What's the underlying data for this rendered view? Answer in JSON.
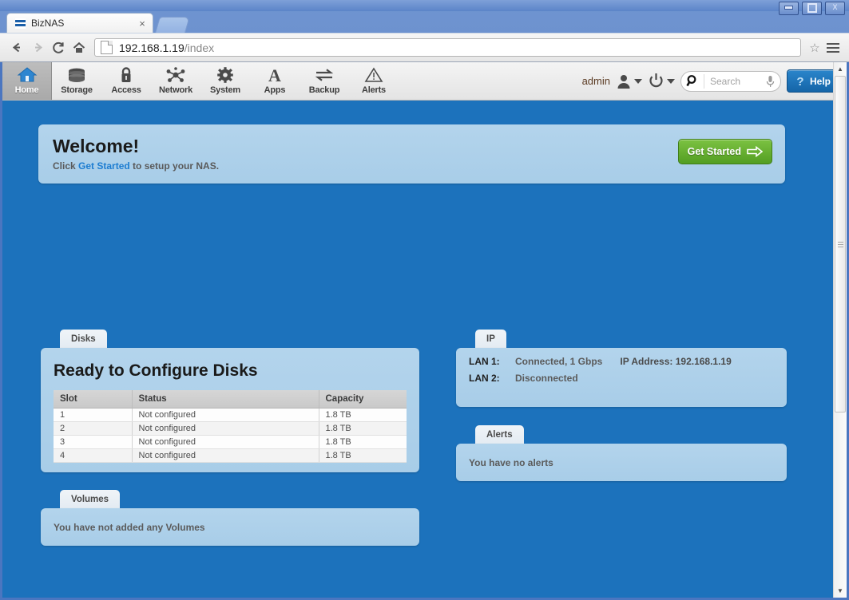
{
  "window": {
    "minimize_label": "Minimize",
    "maximize_label": "Maximize",
    "close_label": "X"
  },
  "browser": {
    "tab": {
      "title": "BizNAS",
      "close_label": "×",
      "favicon": "biznas-stripes-icon"
    },
    "newtab_label": "New Tab",
    "back_label": "←",
    "forward_label": "→",
    "reload_label": "C",
    "home_label": "Home",
    "url": "192.168.1.19",
    "url_path": "/index",
    "star_label": "☆",
    "menu_label": "Menu"
  },
  "appnav": {
    "items": [
      {
        "label": "Home",
        "icon": "house-icon",
        "active": true
      },
      {
        "label": "Storage",
        "icon": "disk-stack-icon",
        "active": false
      },
      {
        "label": "Access",
        "icon": "lock-icon",
        "active": false
      },
      {
        "label": "Network",
        "icon": "network-nodes-icon",
        "active": false
      },
      {
        "label": "System",
        "icon": "gear-icon",
        "active": false
      },
      {
        "label": "Apps",
        "icon": "letter-a-icon",
        "active": false
      },
      {
        "label": "Backup",
        "icon": "two-arrows-icon",
        "active": false
      },
      {
        "label": "Alerts",
        "icon": "warning-triangle-icon",
        "active": false
      }
    ],
    "user": "admin",
    "user_icon": "person-icon",
    "power_icon": "power-icon",
    "search": {
      "placeholder": "Search",
      "value": "",
      "icon": "search-icon",
      "mic_icon": "microphone-icon"
    },
    "help": {
      "label": "Help",
      "icon": "question-mark-icon"
    }
  },
  "welcome": {
    "heading": "Welcome!",
    "prefix": "Click ",
    "link": "Get Started",
    "suffix": " to setup your NAS.",
    "button_label": "Get Started",
    "button_icon": "arrow-right-icon",
    "button_color": "#6fb939"
  },
  "disks": {
    "tab_label": "Disks",
    "heading": "Ready to Configure Disks",
    "columns": [
      "Slot",
      "Status",
      "Capacity"
    ],
    "rows": [
      [
        "1",
        "Not configured",
        "1.8 TB"
      ],
      [
        "2",
        "Not configured",
        "1.8 TB"
      ],
      [
        "3",
        "Not configured",
        "1.8 TB"
      ],
      [
        "4",
        "Not configured",
        "1.8 TB"
      ]
    ]
  },
  "volumes": {
    "tab_label": "Volumes",
    "message": "You have not added any Volumes"
  },
  "ip": {
    "tab_label": "IP",
    "rows": [
      {
        "key": "LAN 1:",
        "status": "Connected, 1 Gbps",
        "address": "IP Address: 192.168.1.19"
      },
      {
        "key": "LAN 2:",
        "status": "Disconnected",
        "address": ""
      }
    ]
  },
  "alerts": {
    "tab_label": "Alerts",
    "message": "You have no alerts"
  },
  "theme": {
    "page_background": "#1c72bc",
    "panel_background": "#aed0ea",
    "accent": "#1b75bb",
    "success": "#6fb939"
  },
  "scrollbar": {
    "up_label": "▲",
    "down_label": "▼"
  }
}
